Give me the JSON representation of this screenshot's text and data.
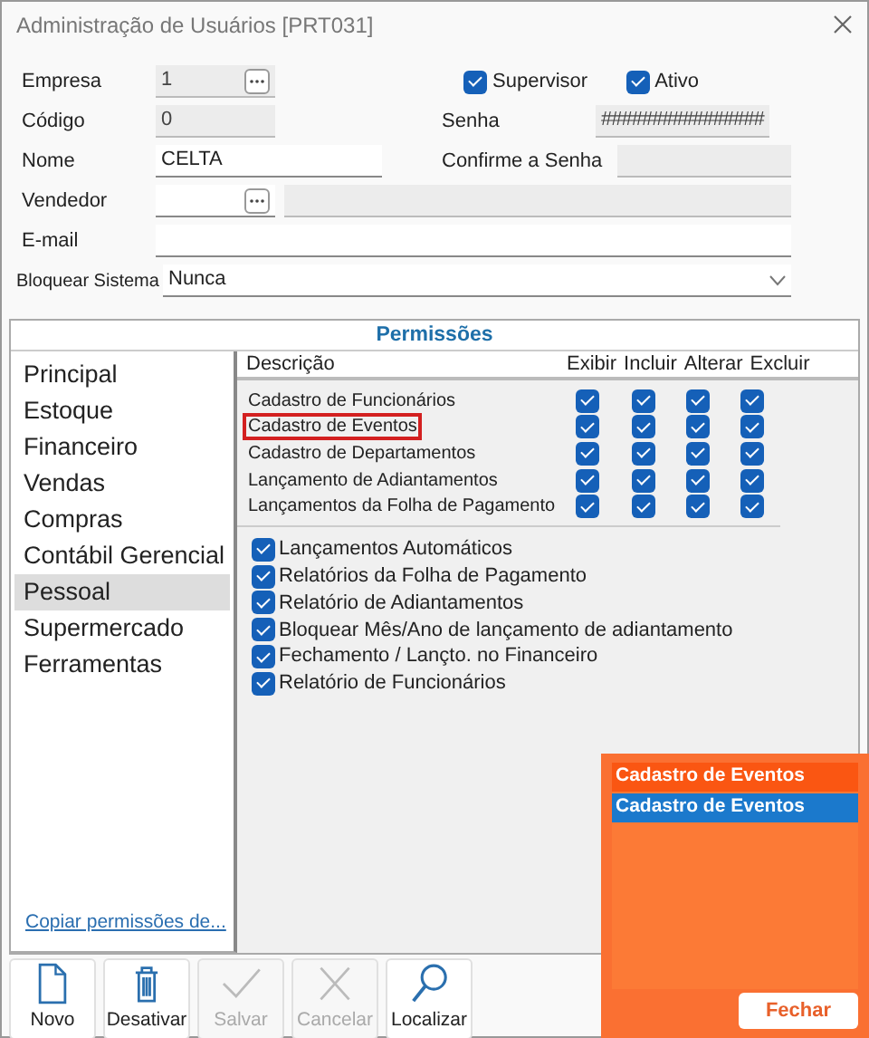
{
  "window": {
    "title": "Administração de Usuários [PRT031]"
  },
  "form": {
    "empresa": {
      "label": "Empresa",
      "value": "1",
      "disabled": true
    },
    "codigo": {
      "label": "Código",
      "value": "0",
      "disabled": true
    },
    "nome": {
      "label": "Nome",
      "value": "CELTA"
    },
    "vendedor": {
      "label": "Vendedor"
    },
    "email": {
      "label": "E-mail"
    },
    "bloquear": {
      "label": "Bloquear Sistema",
      "value": "Nunca"
    },
    "supervisor": {
      "label": "Supervisor",
      "checked": true
    },
    "ativo": {
      "label": "Ativo",
      "checked": true
    },
    "senha": {
      "label": "Senha",
      "value": "################"
    },
    "confirme": {
      "label": "Confirme a Senha"
    }
  },
  "permissions": {
    "title": "Permissões",
    "modules": [
      {
        "label": "Principal",
        "selected": false
      },
      {
        "label": "Estoque",
        "selected": false
      },
      {
        "label": "Financeiro",
        "selected": false
      },
      {
        "label": "Vendas",
        "selected": false
      },
      {
        "label": "Compras",
        "selected": false
      },
      {
        "label": "Contábil Gerencial",
        "selected": false
      },
      {
        "label": "Pessoal",
        "selected": true
      },
      {
        "label": "Supermercado",
        "selected": false
      },
      {
        "label": "Ferramentas",
        "selected": false
      }
    ],
    "copy_link": "Copiar permissões de...",
    "columns": [
      "Descrição",
      "Exibir",
      "Incluir",
      "Alterar",
      "Excluir"
    ],
    "rows": [
      {
        "label": "Cadastro de Funcionários",
        "highlighted": false,
        "rights": [
          {
            "checked": true
          },
          {
            "checked": true
          },
          {
            "checked": true
          },
          {
            "checked": true
          }
        ]
      },
      {
        "label": "Cadastro de Eventos",
        "highlighted": true,
        "rights": [
          {
            "checked": true
          },
          {
            "checked": true
          },
          {
            "checked": true
          },
          {
            "checked": true
          }
        ]
      },
      {
        "label": "Cadastro de Departamentos",
        "highlighted": false,
        "rights": [
          {
            "checked": true
          },
          {
            "checked": true
          },
          {
            "checked": true
          },
          {
            "checked": true
          }
        ]
      },
      {
        "label": "Lançamento de Adiantamentos",
        "highlighted": false,
        "rights": [
          {
            "checked": true
          },
          {
            "checked": true
          },
          {
            "checked": true
          },
          {
            "checked": true
          }
        ]
      },
      {
        "label": "Lançamentos da Folha de Pagamento",
        "highlighted": false,
        "rights": [
          {
            "checked": true
          },
          {
            "checked": true
          },
          {
            "checked": true
          },
          {
            "checked": true
          }
        ]
      }
    ],
    "options": [
      {
        "label": "Lançamentos Automáticos",
        "checked": true
      },
      {
        "label": "Relatórios da Folha de Pagamento",
        "checked": true
      },
      {
        "label": "Relatório de Adiantamentos",
        "checked": true
      },
      {
        "label": "Bloquear Mês/Ano de lançamento de adiantamento",
        "checked": true
      },
      {
        "label": "Fechamento / Lançto. no Financeiro",
        "checked": true
      },
      {
        "label": "Relatório de Funcionários",
        "checked": true
      }
    ]
  },
  "toolbar": [
    {
      "label": "Novo",
      "kind": "new",
      "disabled": false
    },
    {
      "label": "Desativar",
      "kind": "delete",
      "disabled": false
    },
    {
      "label": "Salvar",
      "kind": "save",
      "disabled": true
    },
    {
      "label": "Cancelar",
      "kind": "cancel",
      "disabled": true
    },
    {
      "label": "Localizar",
      "kind": "search",
      "disabled": false
    }
  ],
  "search_popup": {
    "items": [
      {
        "label": "Cadastro de Eventos",
        "selected": false
      },
      {
        "label": "Cadastro de Eventos",
        "selected": true
      }
    ],
    "close_button": "Fechar"
  }
}
